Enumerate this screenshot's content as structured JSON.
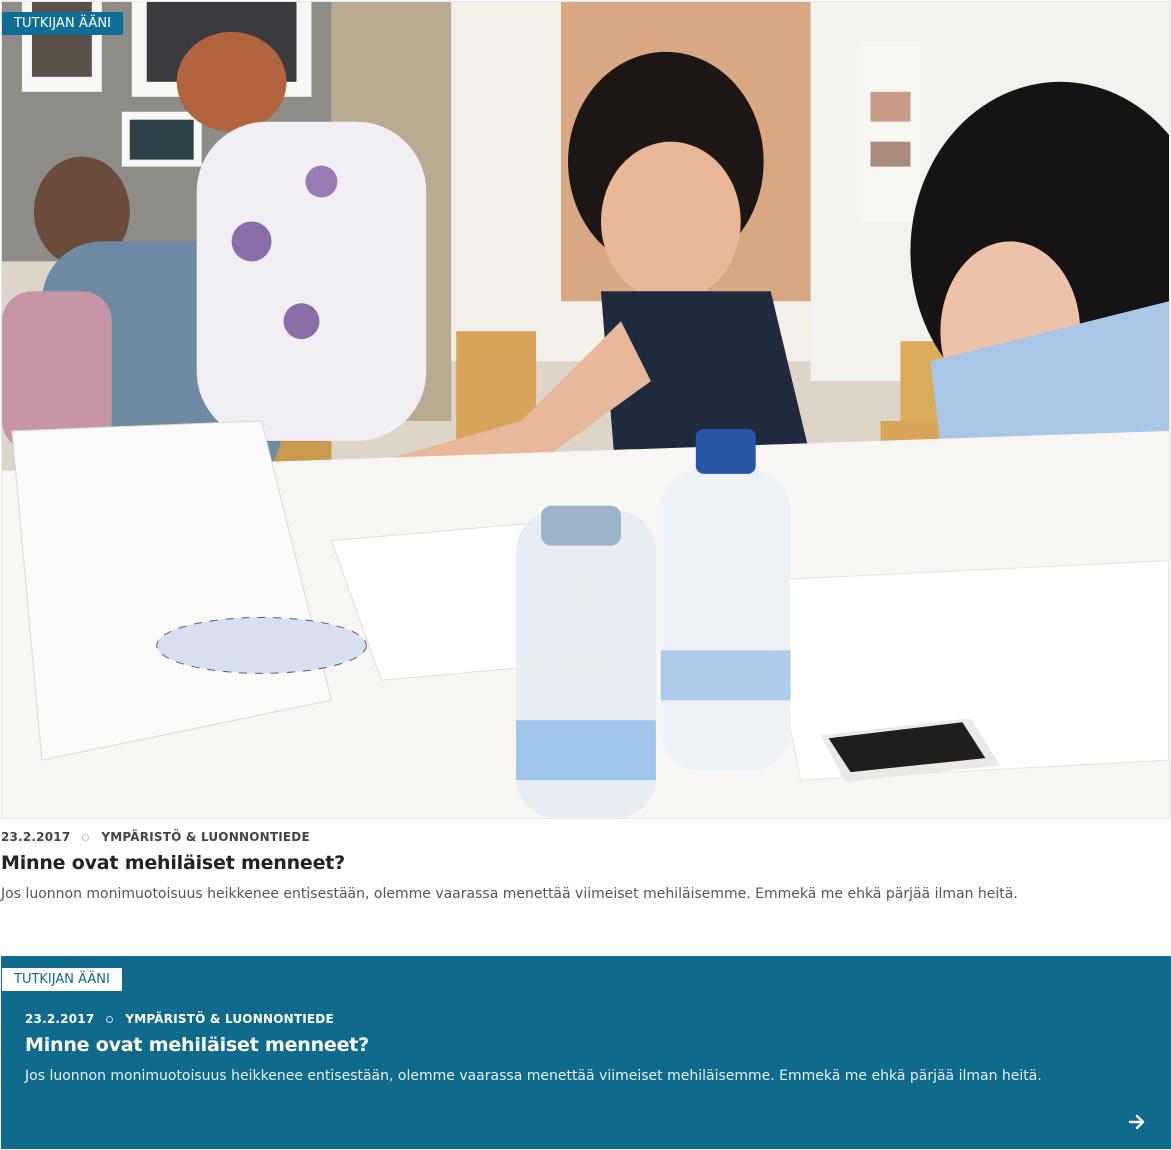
{
  "featured": {
    "image_alt": "Students working at a table with water bottles",
    "tag": "TUTKIJAN ÄÄNI",
    "date": "23.2.2017",
    "category": "YMPÄRISTÖ & LUONNONTIEDE",
    "title": "Minne ovat mehiläiset menneet?",
    "excerpt": "Jos luonnon monimuotoisuus heikkenee entisestään, olemme vaarassa menettää viimeiset mehiläisemme. Emmekä me ehkä pärjää ilman heitä."
  },
  "highlight": {
    "tag": "TUTKIJAN ÄÄNI",
    "date": "23.2.2017",
    "category": "YMPÄRISTÖ & LUONNONTIEDE",
    "title": "Minne ovat mehiläiset menneet?",
    "excerpt": "Jos luonnon monimuotoisuus heikkenee entisestään, olemme vaarassa menettää viimeiset mehiläisemme. Emmekä me ehkä pärjää ilman heitä.",
    "arrow_icon": "arrow-right-icon"
  },
  "colors": {
    "accent_blue": "#0f6a8c",
    "tag_blue": "#0f6e96"
  }
}
